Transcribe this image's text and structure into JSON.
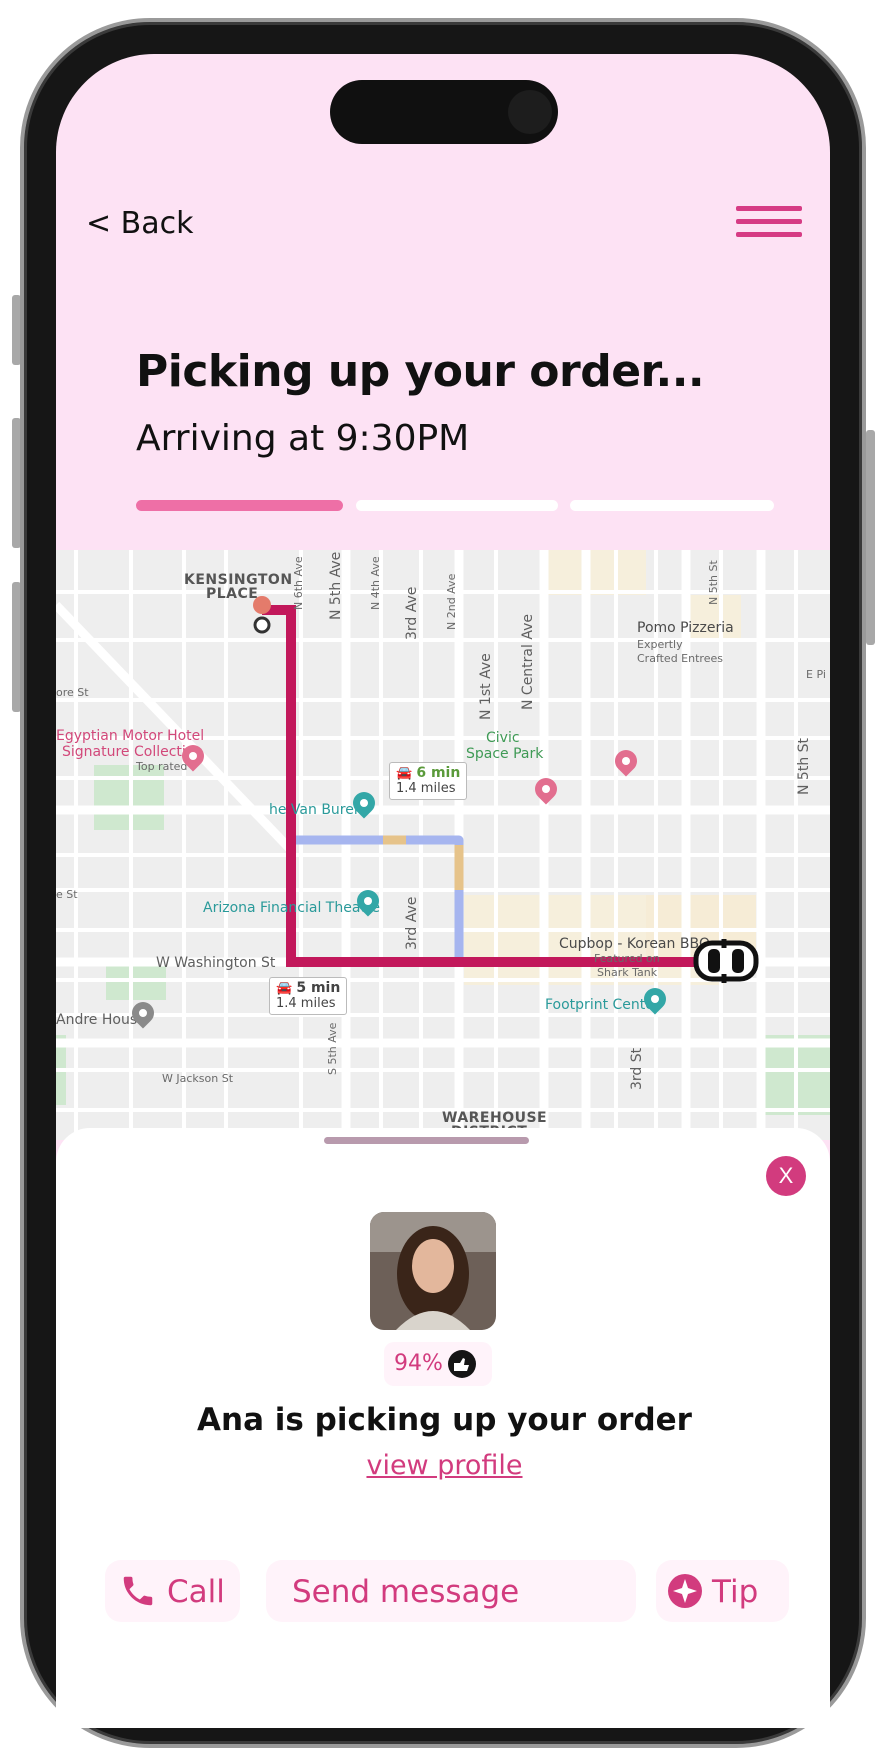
{
  "header": {
    "back_label": "< Back",
    "title": "Picking up your order...",
    "subtitle": "Arriving at 9:30PM",
    "progress_steps": [
      {
        "state": "active",
        "color": "#ee6fa6"
      },
      {
        "state": "pending",
        "color": "#ffffff"
      },
      {
        "state": "pending",
        "color": "#ffffff"
      }
    ]
  },
  "map": {
    "area_labels": [
      "KENSINGTON",
      "PLACE",
      "WAREHOUSE",
      "DISTRICT"
    ],
    "streets": [
      "N 6th Ave",
      "N 5th Ave",
      "N 4th Ave",
      "3rd Ave",
      "N 2nd Ave",
      "N 1st Ave",
      "N Central Ave",
      "N 5th St",
      "W Washington St",
      "W Jackson St",
      "S 5th Ave",
      "3rd Ave",
      "3rd St",
      "ore St",
      "e St",
      "E Pi",
      "N 5th St"
    ],
    "places": {
      "pomo": {
        "name": "Pomo Pizzeria",
        "line2": "Expertly",
        "line3": "Crafted Entrees"
      },
      "hotel": {
        "name": "Egyptian Motor Hotel",
        "line2": "Signature Collection",
        "line3": "Top rated"
      },
      "park": {
        "name": "Civic",
        "line2": "Space Park"
      },
      "vanburen": "he Van Buren",
      "theatre": "Arizona Financial Theatre",
      "cupbop": {
        "name": "Cupbop - Korean BBQ",
        "line2": "Featured on",
        "line3": "Shark Tank"
      },
      "footprint": "Footprint Center",
      "andre": "Andre House"
    },
    "route_alt": {
      "time": "6 min",
      "distance": "1.4 miles"
    },
    "route_main": {
      "time": "5 min",
      "distance": "1.4 miles"
    }
  },
  "driver": {
    "rating": "94%",
    "headline": "Ana is picking up your order",
    "profile_link": "view profile"
  },
  "actions": {
    "call": "Call",
    "message": "Send message",
    "tip": "Tip",
    "close": "X"
  },
  "colors": {
    "accent": "#d23b7e",
    "route": "#c2185b",
    "header_bg": "#fde2f4"
  }
}
